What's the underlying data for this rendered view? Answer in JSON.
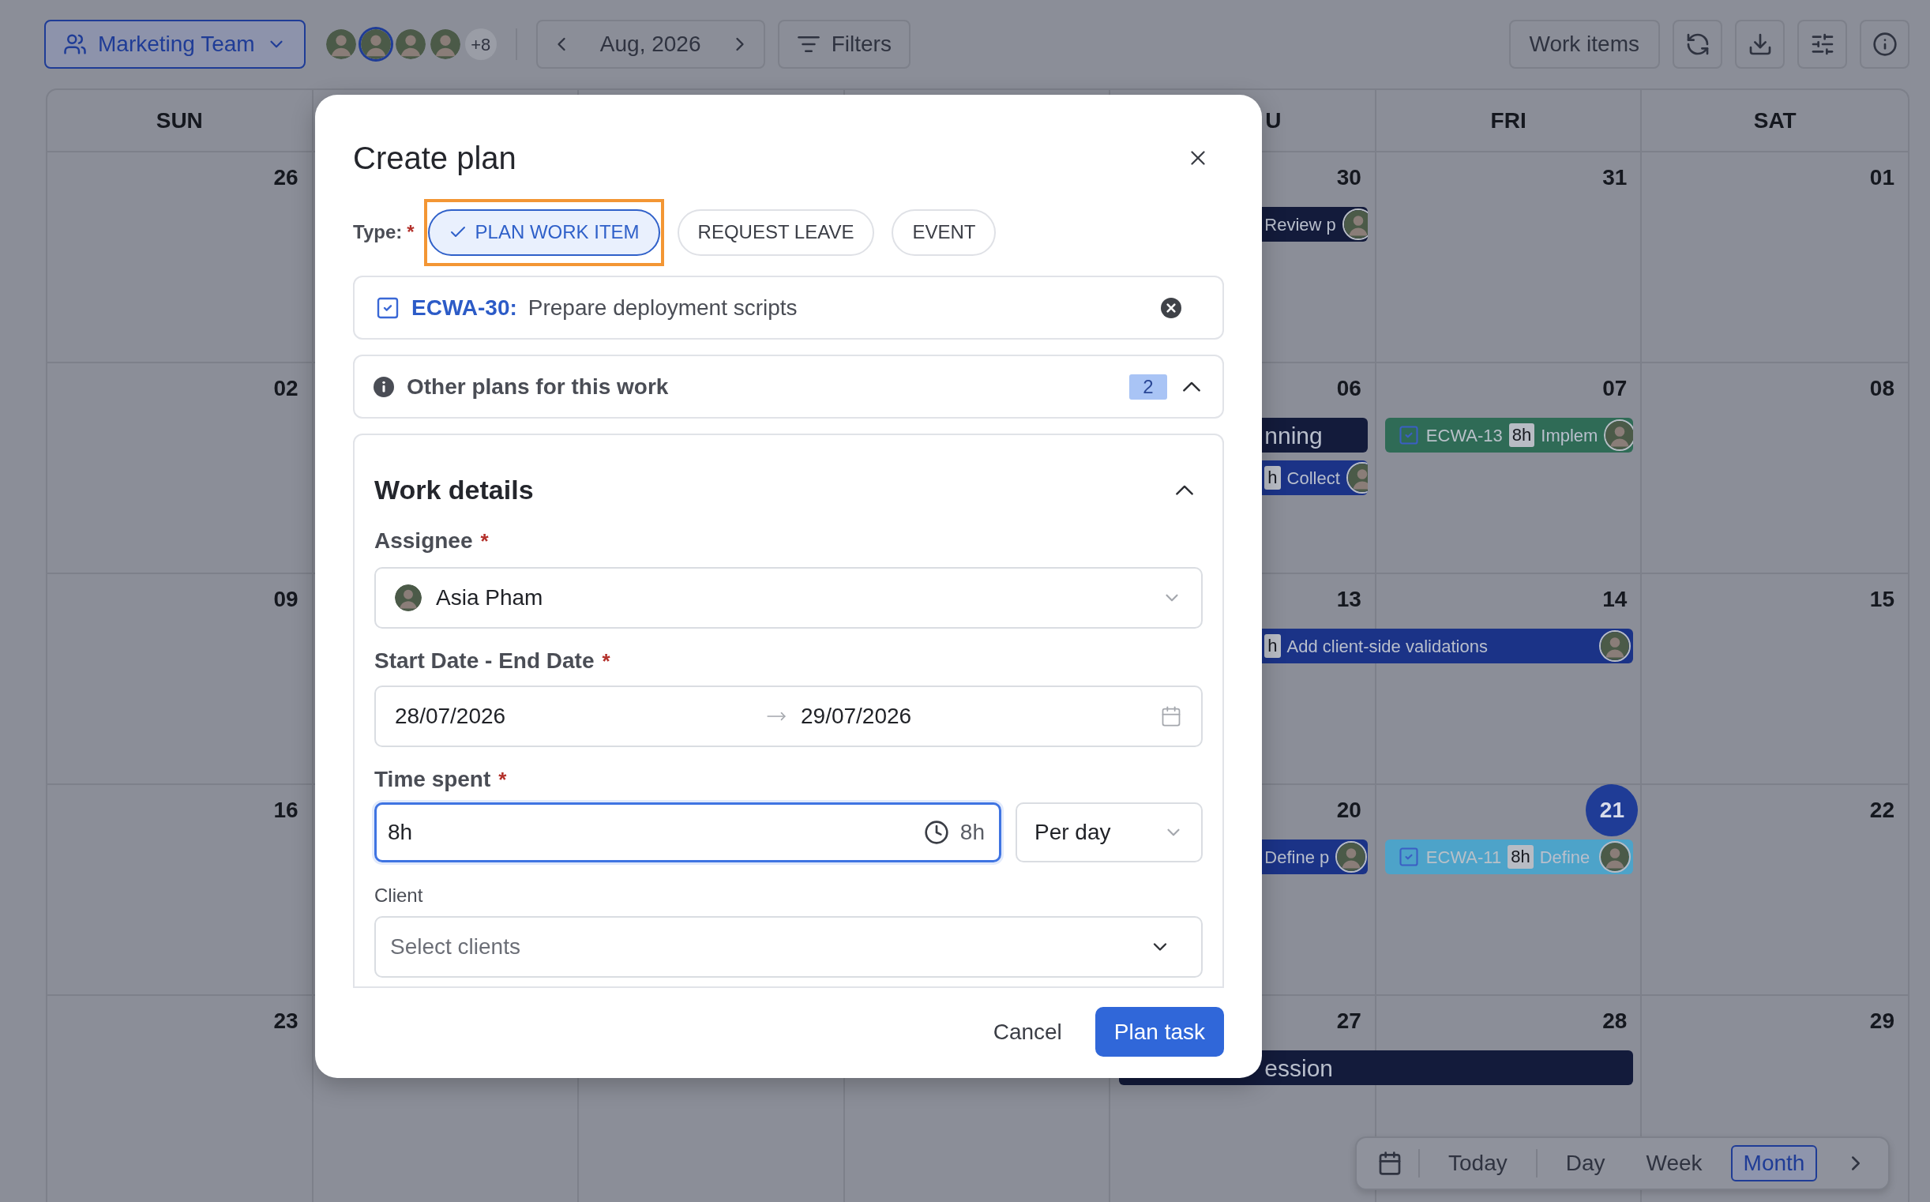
{
  "toolbar": {
    "team": "Marketing Team",
    "avatars": [
      {
        "selected": false
      },
      {
        "selected": true
      },
      {
        "selected": false
      },
      {
        "selected": false
      }
    ],
    "more": "+8",
    "period": "Aug, 2026",
    "filters": "Filters",
    "view_mode": "Work items"
  },
  "calendar": {
    "headers": [
      {
        "kind": "open",
        "label": "SUN"
      },
      {
        "kind": "covered"
      },
      {
        "kind": "covered"
      },
      {
        "kind": "covered"
      },
      {
        "kind": "open",
        "label": "U"
      },
      {
        "kind": "open",
        "label": "FRI"
      },
      {
        "kind": "open",
        "label": "SAT"
      }
    ],
    "weeks": [
      {
        "days": [
          {
            "kind": "open",
            "date": "26",
            "today": false
          },
          {
            "kind": "covered"
          },
          {
            "kind": "covered"
          },
          {
            "kind": "covered"
          },
          {
            "kind": "open",
            "date": "30",
            "today": false,
            "events": [
              {
                "kind": "tail",
                "color": "#131b3b",
                "title": "Review p"
              }
            ]
          },
          {
            "kind": "open",
            "date": "31",
            "today": false
          },
          {
            "kind": "open",
            "date": "01",
            "today": false
          }
        ]
      },
      {
        "days": [
          {
            "kind": "open",
            "date": "02",
            "today": false
          },
          {
            "kind": "covered"
          },
          {
            "kind": "covered"
          },
          {
            "kind": "covered"
          },
          {
            "kind": "open",
            "date": "06",
            "today": false,
            "events": [
              {
                "kind": "heading-tail",
                "color": "#131b3b",
                "title": "nning"
              },
              {
                "kind": "tail",
                "color": "#1b3387",
                "hours": "h",
                "title": "Collect"
              }
            ]
          },
          {
            "kind": "open",
            "date": "07",
            "today": false,
            "events": [
              {
                "kind": "task",
                "color": "#2f6b56",
                "key": "ECWA-13",
                "hours": "8h",
                "title": "Implem"
              }
            ]
          },
          {
            "kind": "open",
            "date": "08",
            "today": false
          }
        ]
      },
      {
        "days": [
          {
            "kind": "open",
            "date": "09",
            "today": false
          },
          {
            "kind": "covered"
          },
          {
            "kind": "covered"
          },
          {
            "kind": "covered"
          },
          {
            "kind": "open",
            "date": "13",
            "today": false,
            "events": [
              {
                "kind": "wide-tail",
                "color": "#1b3387",
                "hours": "h",
                "title": "Add client-side validations"
              }
            ]
          },
          {
            "kind": "open",
            "date": "14",
            "today": false
          },
          {
            "kind": "open",
            "date": "15",
            "today": false
          }
        ]
      },
      {
        "days": [
          {
            "kind": "open",
            "date": "16",
            "today": false
          },
          {
            "kind": "covered"
          },
          {
            "kind": "covered"
          },
          {
            "kind": "covered"
          },
          {
            "kind": "open",
            "date": "20",
            "today": false,
            "events": [
              {
                "kind": "tail",
                "color": "#1b3387",
                "title": "Define p"
              }
            ]
          },
          {
            "kind": "open",
            "date": "21",
            "today": true,
            "events": [
              {
                "kind": "task",
                "color": "#4da3c9",
                "key": "ECWA-11",
                "hours": "8h",
                "title": "Define"
              }
            ]
          },
          {
            "kind": "open",
            "date": "22",
            "today": false
          }
        ]
      },
      {
        "days": [
          {
            "kind": "open",
            "date": "23",
            "today": false
          },
          {
            "kind": "covered"
          },
          {
            "kind": "covered"
          },
          {
            "kind": "covered"
          },
          {
            "kind": "open",
            "date": "27",
            "today": false,
            "events": [
              {
                "kind": "wide-heading-tail",
                "color": "#131b3b",
                "title": "ession"
              }
            ]
          },
          {
            "kind": "open",
            "date": "28",
            "today": false
          },
          {
            "kind": "open",
            "date": "29",
            "today": false
          }
        ]
      }
    ]
  },
  "modal": {
    "title": "Create plan",
    "type_label": "Type:",
    "type_required_mark": "*",
    "types": [
      {
        "label": "PLAN WORK ITEM",
        "selected": true,
        "highlighted": true
      },
      {
        "label": "REQUEST LEAVE",
        "selected": false,
        "highlighted": false
      },
      {
        "label": "EVENT",
        "selected": false,
        "highlighted": false
      }
    ],
    "work_item": {
      "key": "ECWA-30:",
      "title": "Prepare deployment scripts"
    },
    "other_plans": {
      "label": "Other plans for this work",
      "count": "2",
      "expanded": true
    },
    "work_details": {
      "title": "Work details",
      "expanded": true,
      "assignee": {
        "label": "Assignee",
        "required_mark": "*",
        "value": "Asia Pham"
      },
      "dates": {
        "label": "Start Date - End Date",
        "required_mark": "*",
        "start": "28/07/2026",
        "end": "29/07/2026"
      },
      "time_spent": {
        "label": "Time spent",
        "required_mark": "*",
        "value": "8h",
        "hint": "8h",
        "unit": "Per day"
      },
      "client": {
        "label": "Client",
        "placeholder": "Select clients"
      }
    },
    "actions": {
      "cancel": "Cancel",
      "submit": "Plan task"
    }
  },
  "view_switcher": {
    "items": [
      {
        "label": "Today",
        "selected": false
      },
      {
        "label": "Day",
        "selected": false
      },
      {
        "label": "Week",
        "selected": false
      },
      {
        "label": "Month",
        "selected": true
      }
    ]
  }
}
